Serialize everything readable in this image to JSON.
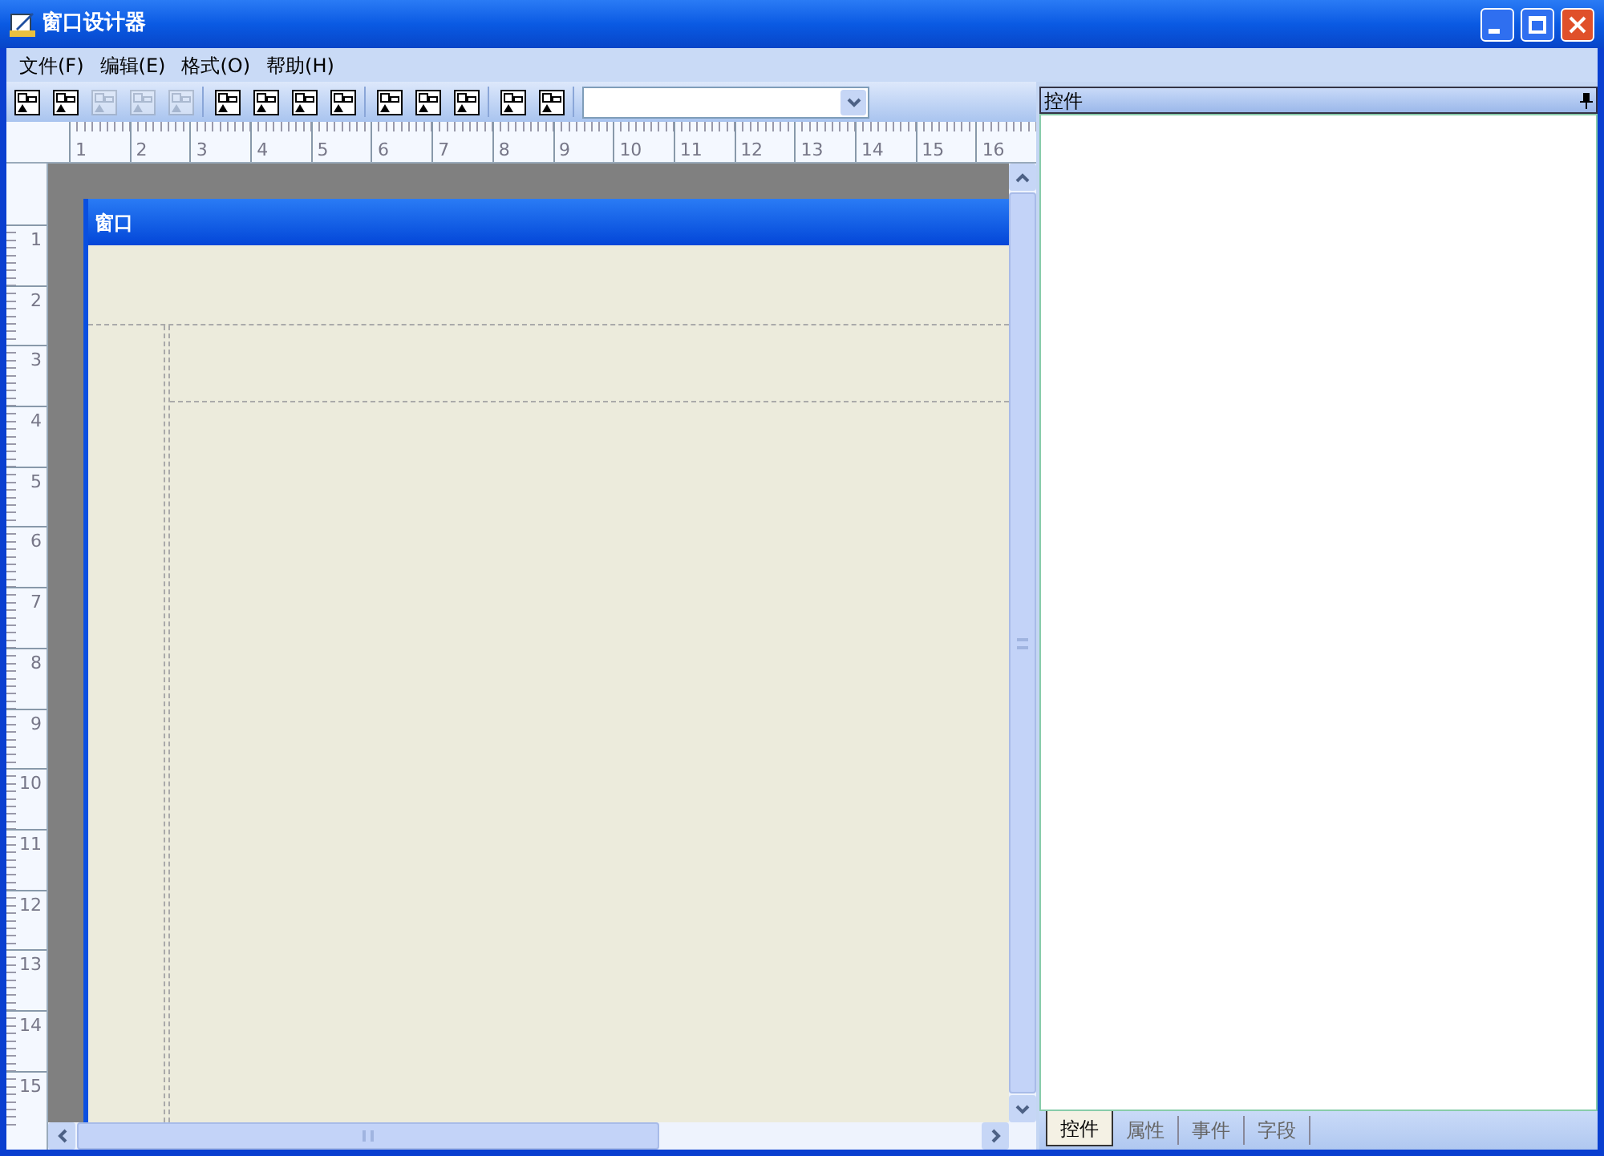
{
  "window": {
    "title": "窗口设计器"
  },
  "menu": [
    {
      "label": "文件(F)"
    },
    {
      "label": "编辑(E)"
    },
    {
      "label": "格式(O)"
    },
    {
      "label": "帮助(H)"
    }
  ],
  "toolbar": {
    "groups": [
      {
        "buttons": [
          {
            "disabled": false
          },
          {
            "disabled": false
          },
          {
            "disabled": true
          },
          {
            "disabled": true
          },
          {
            "disabled": true
          }
        ]
      },
      {
        "buttons": [
          {
            "disabled": false
          },
          {
            "disabled": false
          },
          {
            "disabled": false
          },
          {
            "disabled": false
          }
        ]
      },
      {
        "buttons": [
          {
            "disabled": false
          },
          {
            "disabled": false
          },
          {
            "disabled": false
          }
        ]
      },
      {
        "buttons": [
          {
            "disabled": false
          },
          {
            "disabled": false
          }
        ]
      }
    ]
  },
  "ruler": {
    "horizontal": [
      "1",
      "2",
      "3",
      "4",
      "5",
      "6",
      "7",
      "8",
      "9",
      "10",
      "11",
      "12",
      "13",
      "14",
      "15",
      "16"
    ],
    "vertical": [
      "1",
      "2",
      "3",
      "4",
      "5",
      "6",
      "7",
      "8",
      "9",
      "10",
      "11",
      "12",
      "13",
      "14",
      "15"
    ]
  },
  "design_window": {
    "title": "窗口"
  },
  "panel": {
    "title": "控件",
    "tabs": [
      {
        "label": "控件",
        "selected": true
      },
      {
        "label": "属性",
        "selected": false
      },
      {
        "label": "事件",
        "selected": false
      },
      {
        "label": "字段",
        "selected": false
      }
    ]
  }
}
